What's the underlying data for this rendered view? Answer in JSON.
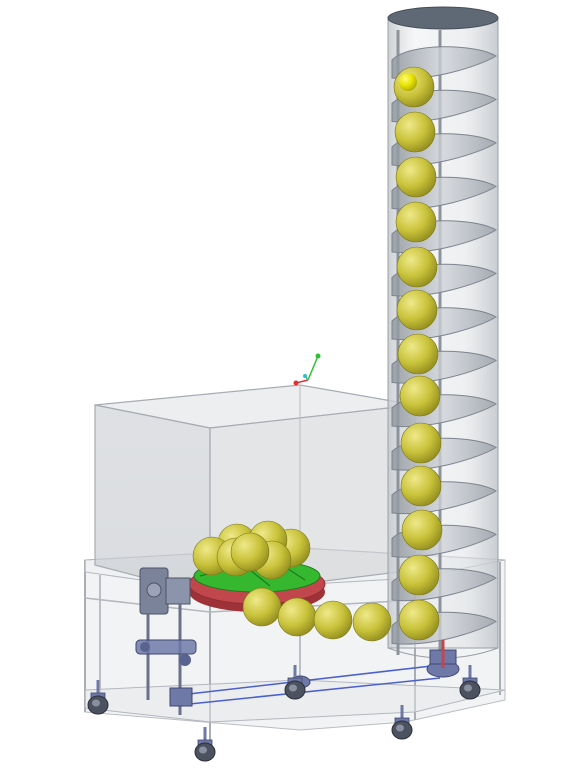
{
  "scene": {
    "background": "#ffffff",
    "colors": {
      "ball_fill": "#c9c23a",
      "ball_highlight": "#efe98a",
      "ball_shade": "#8f8a1c",
      "ball_top_lit": "#e8e400",
      "tube_glass": "#dcdfe3",
      "tube_cap": "#5f6975",
      "helix": "#b9bec6",
      "helix_edge": "#7d848e",
      "hopper_glass": "#d3d6da",
      "frame_glass": "#e2e4e7",
      "disc_green": "#35b830",
      "disc_red": "#c2474d",
      "hardware": "#6f79a8",
      "belt": "#4a5fd0",
      "axis_x": "#e03030",
      "axis_y": "#30c030",
      "axis_z": "#30c0c0"
    },
    "components": [
      "vertical-lift-tube",
      "spiral-screw-conveyor",
      "ball-hopper",
      "rotary-feed-disc",
      "drive-motor",
      "belt-drive",
      "support-frame",
      "caster-wheels",
      "coordinate-triad"
    ],
    "ball_count_in_tube": 13,
    "ball_count_in_hopper": 7,
    "ball_count_in_feed_path": 4,
    "caster_count": 5
  }
}
